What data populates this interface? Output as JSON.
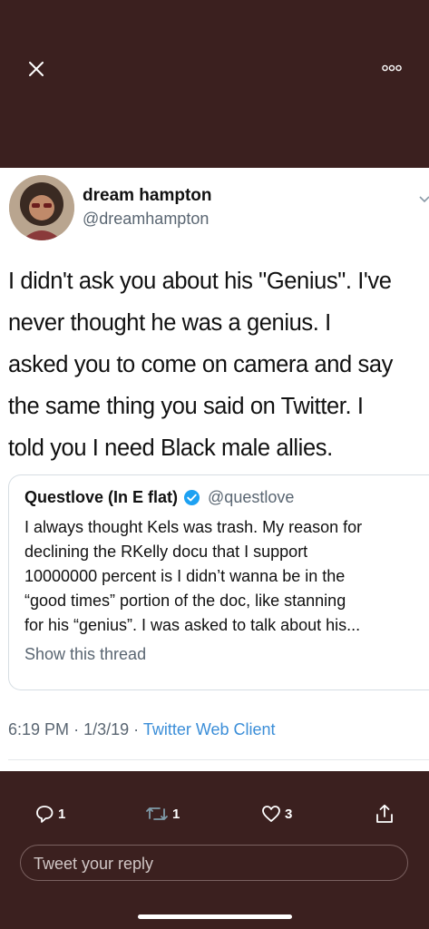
{
  "nav": {
    "close_icon": "close-icon",
    "more_icon": "more-horizontal-icon"
  },
  "tweet": {
    "author_name": "dream hampton",
    "author_handle": "@dreamhampton",
    "lines": [
      "I didn't ask you about his \"Genius\". I've",
      "never thought he was a genius. I",
      "asked you to come on camera and say",
      "the same thing you said on Twitter. I",
      "told you I need Black male allies."
    ],
    "time": "6:19 PM",
    "date": "1/3/19",
    "separator": "·",
    "client": "Twitter Web Client"
  },
  "quoted": {
    "name": "Questlove (In E flat)",
    "handle": "@questlove",
    "lines": [
      "I always thought Kels was trash. My reason for",
      "declining the RKelly docu that I support",
      "10000000 percent is I didn’t wanna be in the",
      "“good times” portion of the doc, like stanning",
      "for his “genius”. I was asked to talk about his..."
    ],
    "show_thread": "Show this thread"
  },
  "actions": {
    "reply_count": "1",
    "retweet_count": "1",
    "like_count": "3",
    "reply_placeholder": "Tweet your reply"
  },
  "colors": {
    "background": "#3b201f",
    "link": "#3b8ed8",
    "secondary_text": "#5a6672",
    "verified": "#1da1f2"
  }
}
